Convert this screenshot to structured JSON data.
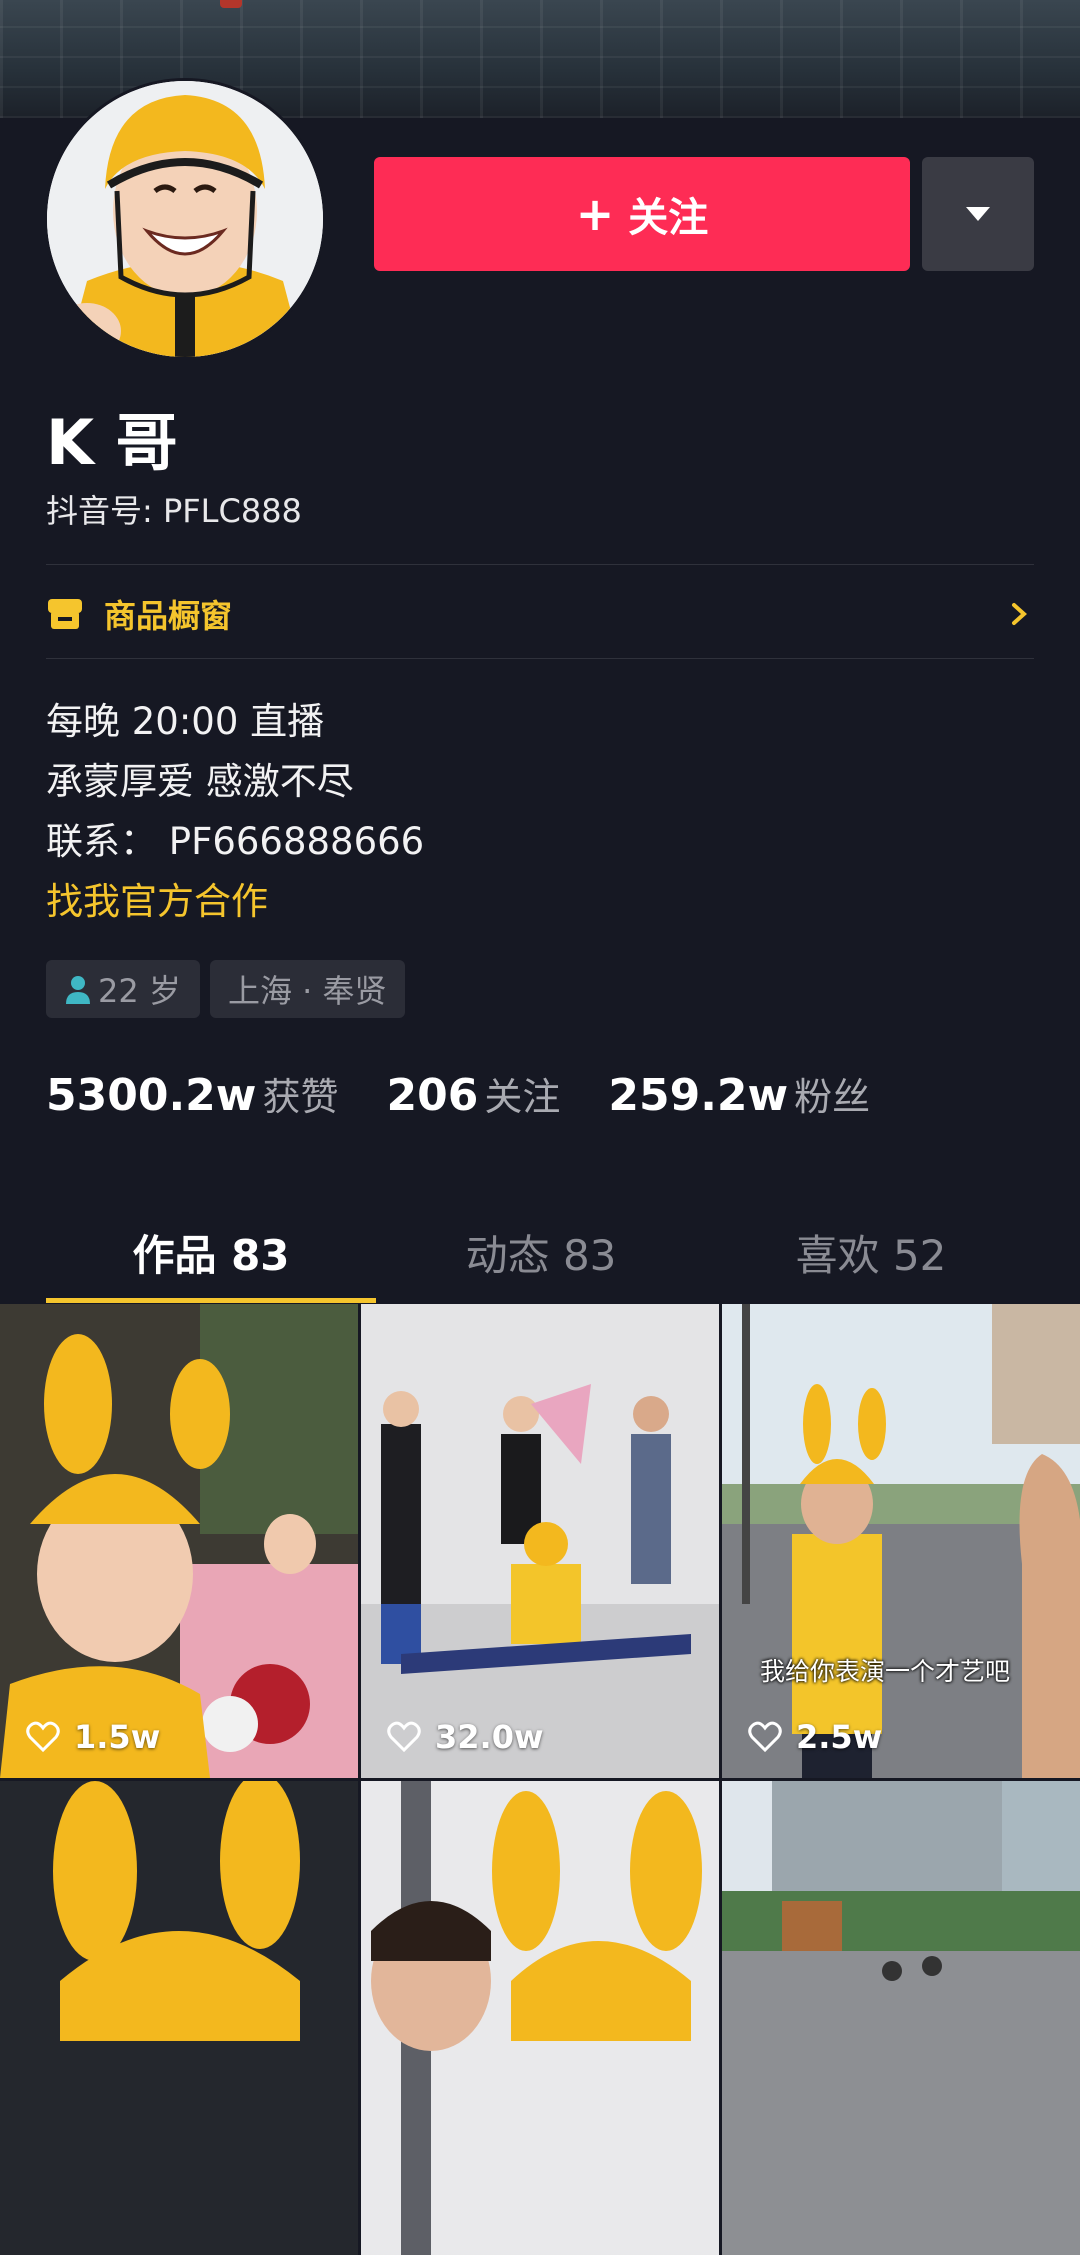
{
  "profile": {
    "follow_label": "关注",
    "name": "K 哥",
    "douyin_id": "抖音号: PFLC888",
    "shop_label": "商品橱窗",
    "bio_lines": [
      "每晚 20:00 直播",
      "承蒙厚爱 感激不尽",
      "联系： PF666888666"
    ],
    "bio_link": "找我官方合作",
    "tags": {
      "age": "22 岁",
      "location": "上海 · 奉贤"
    }
  },
  "stats": [
    {
      "num": "5300.2w",
      "label": "获赞"
    },
    {
      "num": "206",
      "label": "关注"
    },
    {
      "num": "259.2w",
      "label": "粉丝"
    }
  ],
  "tabs": [
    {
      "label": "作品 83"
    },
    {
      "label": "动态 83"
    },
    {
      "label": "喜欢 52"
    }
  ],
  "videos": [
    {
      "likes": "1.5w"
    },
    {
      "likes": "32.0w"
    },
    {
      "likes": "2.5w",
      "caption": "我给你表演一个才艺吧"
    },
    {
      "likes": ""
    },
    {
      "likes": ""
    },
    {
      "likes": ""
    }
  ],
  "colors": {
    "background": "#161823",
    "follow": "#fe2c55",
    "accent": "#f5c52d"
  }
}
